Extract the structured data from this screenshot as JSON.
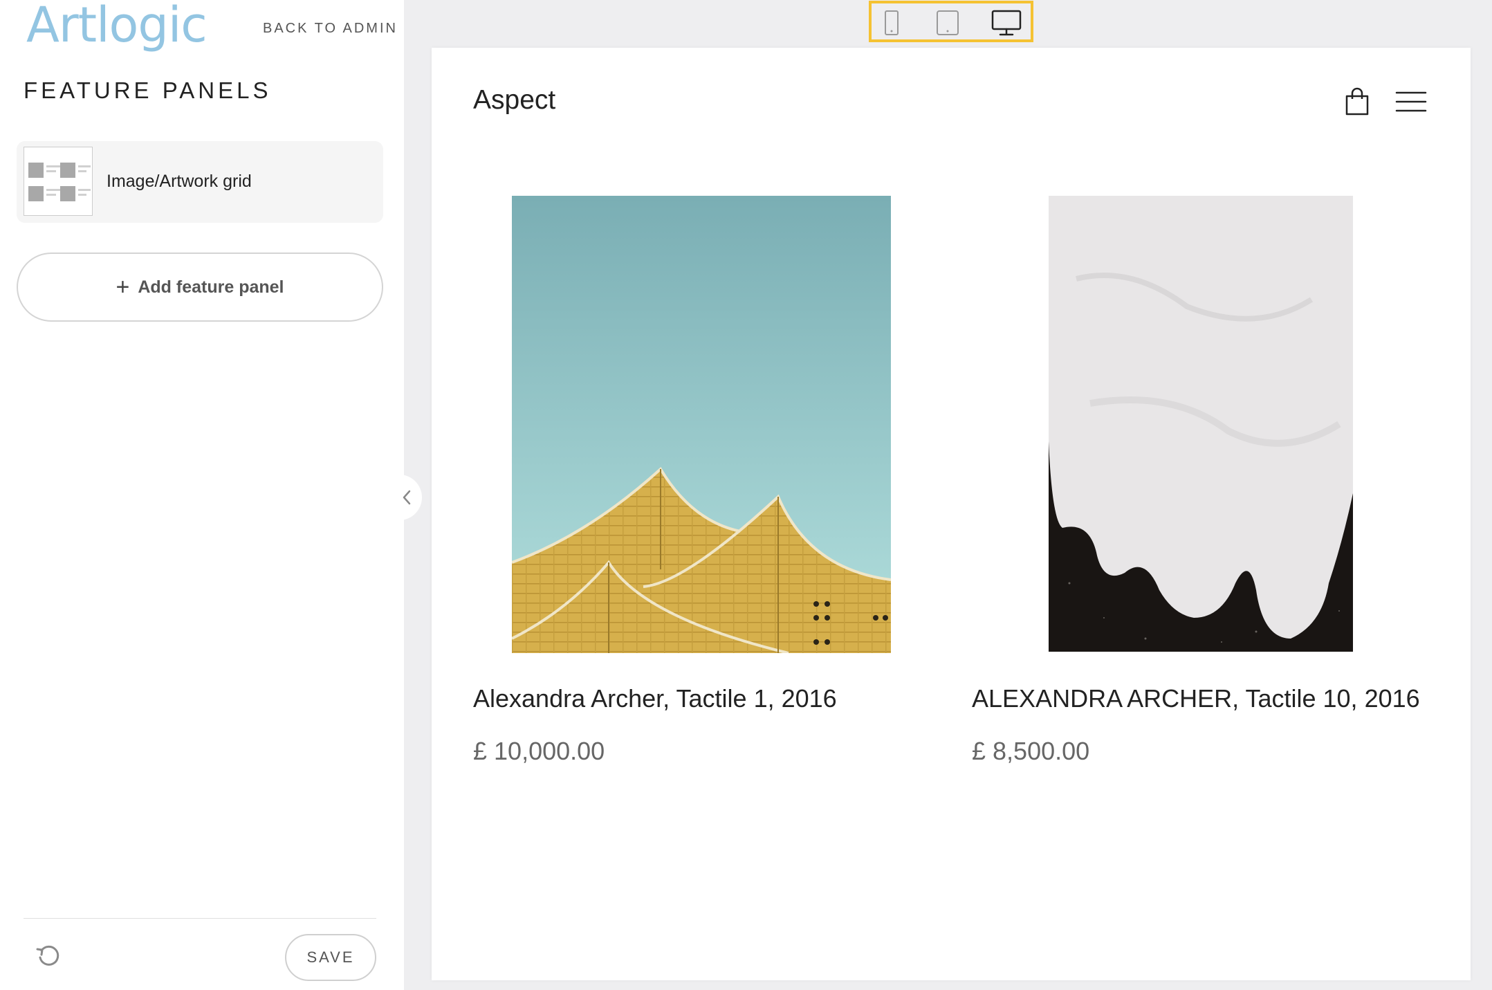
{
  "sidebar": {
    "logo": "Artlogic",
    "back_link": "BACK TO ADMIN",
    "section_title": "FEATURE PANELS",
    "panels": [
      {
        "label": "Image/Artwork grid"
      }
    ],
    "add_panel_label": "Add feature panel",
    "save_label": "SAVE"
  },
  "device_toolbar": {
    "options": [
      "mobile-icon",
      "tablet-icon",
      "desktop-icon"
    ],
    "selected": "desktop",
    "highlight_color": "#f5c232"
  },
  "preview": {
    "site_name": "Aspect",
    "artworks": [
      {
        "title": "Alexandra Archer, Tactile 1, 2016",
        "price": "£ 10,000.00"
      },
      {
        "title": "ALEXANDRA ARCHER, Tactile 10, 2016",
        "price": "£ 8,500.00"
      }
    ]
  },
  "colors": {
    "logo": "#93c5e2",
    "background": "#eeeef0"
  }
}
